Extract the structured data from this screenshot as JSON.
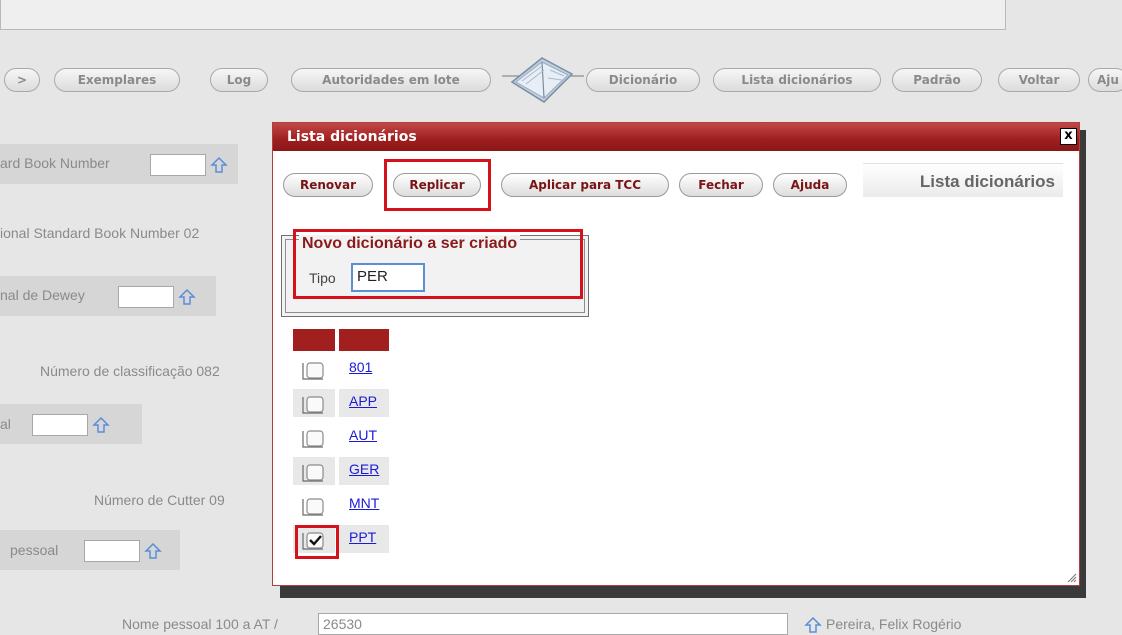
{
  "background": {
    "toolbar": [
      {
        "label": ">"
      },
      {
        "label": "Exemplares"
      },
      {
        "label": "Log"
      },
      {
        "label": "Autoridades em lote"
      },
      {
        "label": "Dicionário"
      },
      {
        "label": "Lista dicionários"
      },
      {
        "label": "Padrão"
      },
      {
        "label": "Voltar"
      },
      {
        "label": "Aju"
      }
    ],
    "fields": {
      "isbn_label": "ard Book Number",
      "issn_label": "ional Standard Book Number  02",
      "cdd_label": "nal de Dewey",
      "class_label": "Número de classificação  082",
      "local_label": "al",
      "cutter_label": "Número de Cutter  09",
      "pessoal_label": "pessoal",
      "nome_label": "Nome pessoal  100  a  AT  /",
      "nome_value": "26530",
      "author": "Pereira, Felix Rogério"
    }
  },
  "modal": {
    "title": "Lista dicionários",
    "close_label": "x",
    "buttons": {
      "renovar": "Renovar",
      "replicar": "Replicar",
      "aplicar": "Aplicar para TCC",
      "fechar": "Fechar",
      "ajuda": "Ajuda"
    },
    "panel_title": "Lista dicionários",
    "new_dict": {
      "legend": "Novo dicionário a ser criado",
      "tipo_label": "Tipo",
      "tipo_value": "PER"
    },
    "list": [
      {
        "code": "801",
        "checked": false
      },
      {
        "code": "APP",
        "checked": false
      },
      {
        "code": "AUT",
        "checked": false
      },
      {
        "code": "GER",
        "checked": false
      },
      {
        "code": "MNT",
        "checked": false
      },
      {
        "code": "PPT",
        "checked": true
      }
    ]
  },
  "colors": {
    "modal_title_bg": "#9e1e1e",
    "highlight": "#d5121b",
    "link": "#1a1ad8"
  }
}
